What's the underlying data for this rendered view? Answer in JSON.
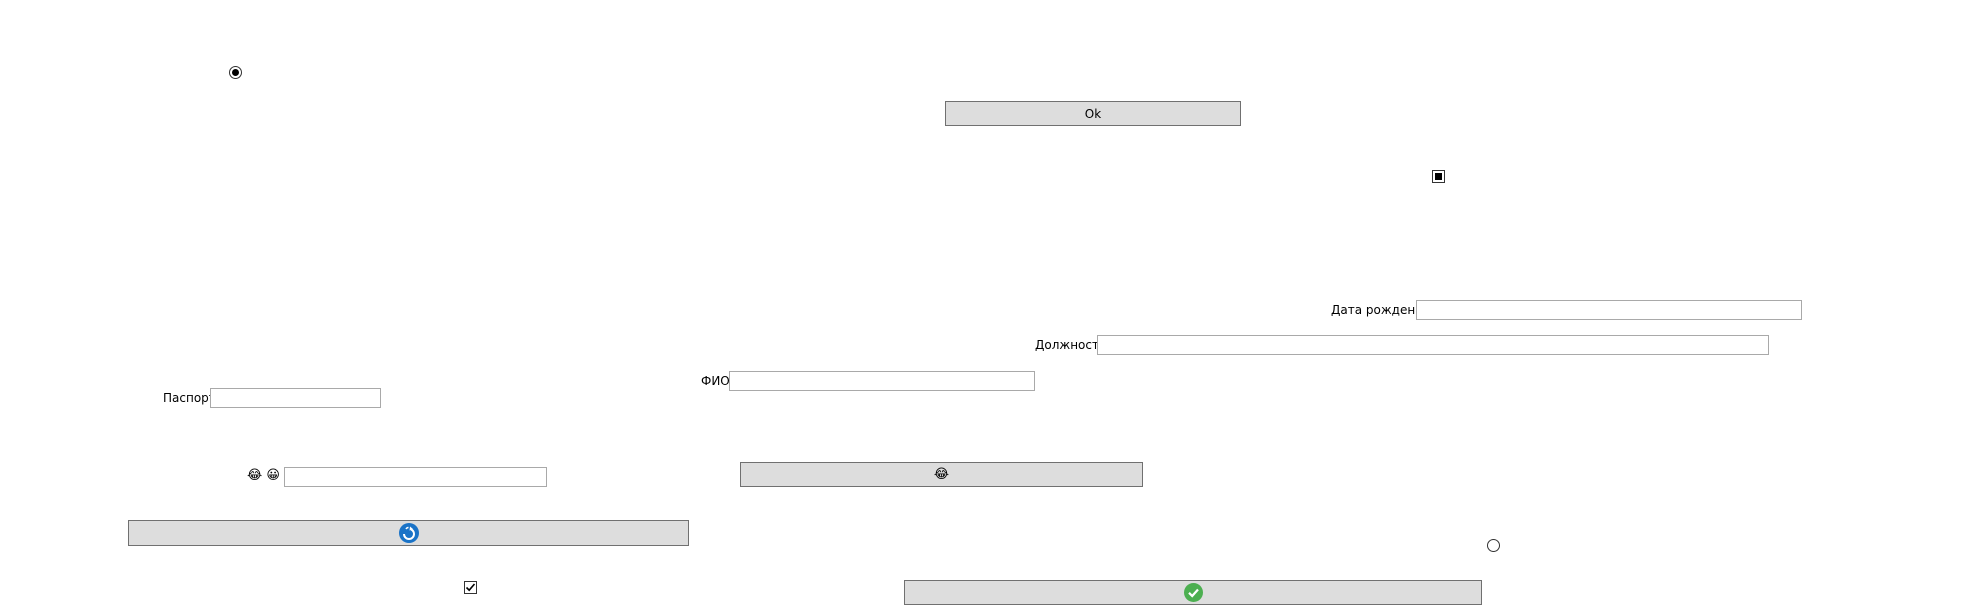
{
  "buttons": {
    "ok_label": "Ok"
  },
  "fields": {
    "birthdate_label": "Дата рождения",
    "position_label": "Должность",
    "fio_label": "ФИО",
    "passport_label": "Паспорт"
  },
  "emoji": {
    "smiley_a": "😂",
    "smiley_b": "😀",
    "button_smiley": "😂"
  },
  "controls": {
    "radio_top_checked": true,
    "radio_bottom_checked": false,
    "checkbox_top_state": "indeterminate",
    "checkbox_bottom_checked": true
  },
  "colors": {
    "button_bg": "#dddddd",
    "button_border": "#707070",
    "textbox_border": "#a9a9a9",
    "refresh_icon": "#1a73c7",
    "confirm_icon": "#4caf50"
  },
  "icons": [
    "refresh-icon",
    "check-circle-icon"
  ]
}
